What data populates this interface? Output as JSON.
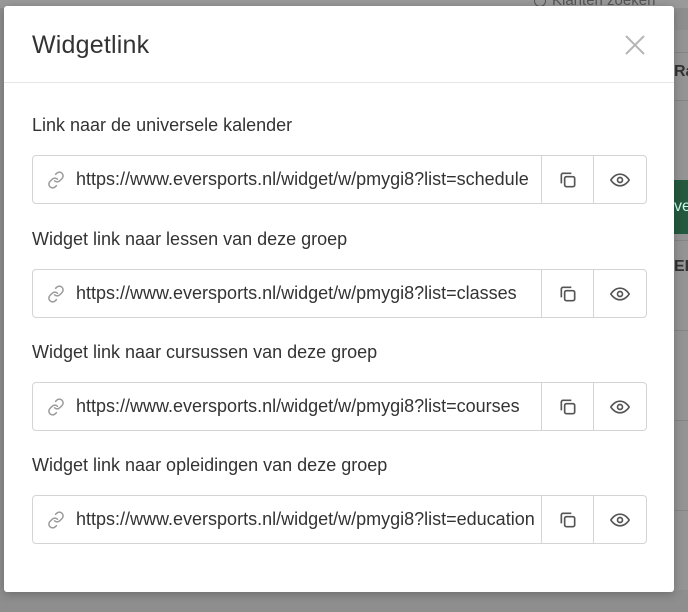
{
  "background": {
    "search_label": "Klanten zoeken",
    "right_text_1": "Ra",
    "right_button": "ve",
    "right_text_2": "EL"
  },
  "modal": {
    "title": "Widgetlink",
    "close_icon": "close-icon",
    "sections": [
      {
        "label": "Link naar de universele kalender",
        "url": "https://www.eversports.nl/widget/w/pmygi8?list=schedule"
      },
      {
        "label": "Widget link naar lessen van deze groep",
        "url": "https://www.eversports.nl/widget/w/pmygi8?list=classes"
      },
      {
        "label": "Widget link naar cursussen van deze groep",
        "url": "https://www.eversports.nl/widget/w/pmygi8?list=courses"
      },
      {
        "label": "Widget link naar opleidingen van deze groep",
        "url": "https://www.eversports.nl/widget/w/pmygi8?list=education"
      }
    ]
  },
  "colors": {
    "text": "#333333",
    "border": "#d4d4d4",
    "icon": "#555555",
    "overlay": "#8e8e8e",
    "brand_green": "#245a3f"
  }
}
